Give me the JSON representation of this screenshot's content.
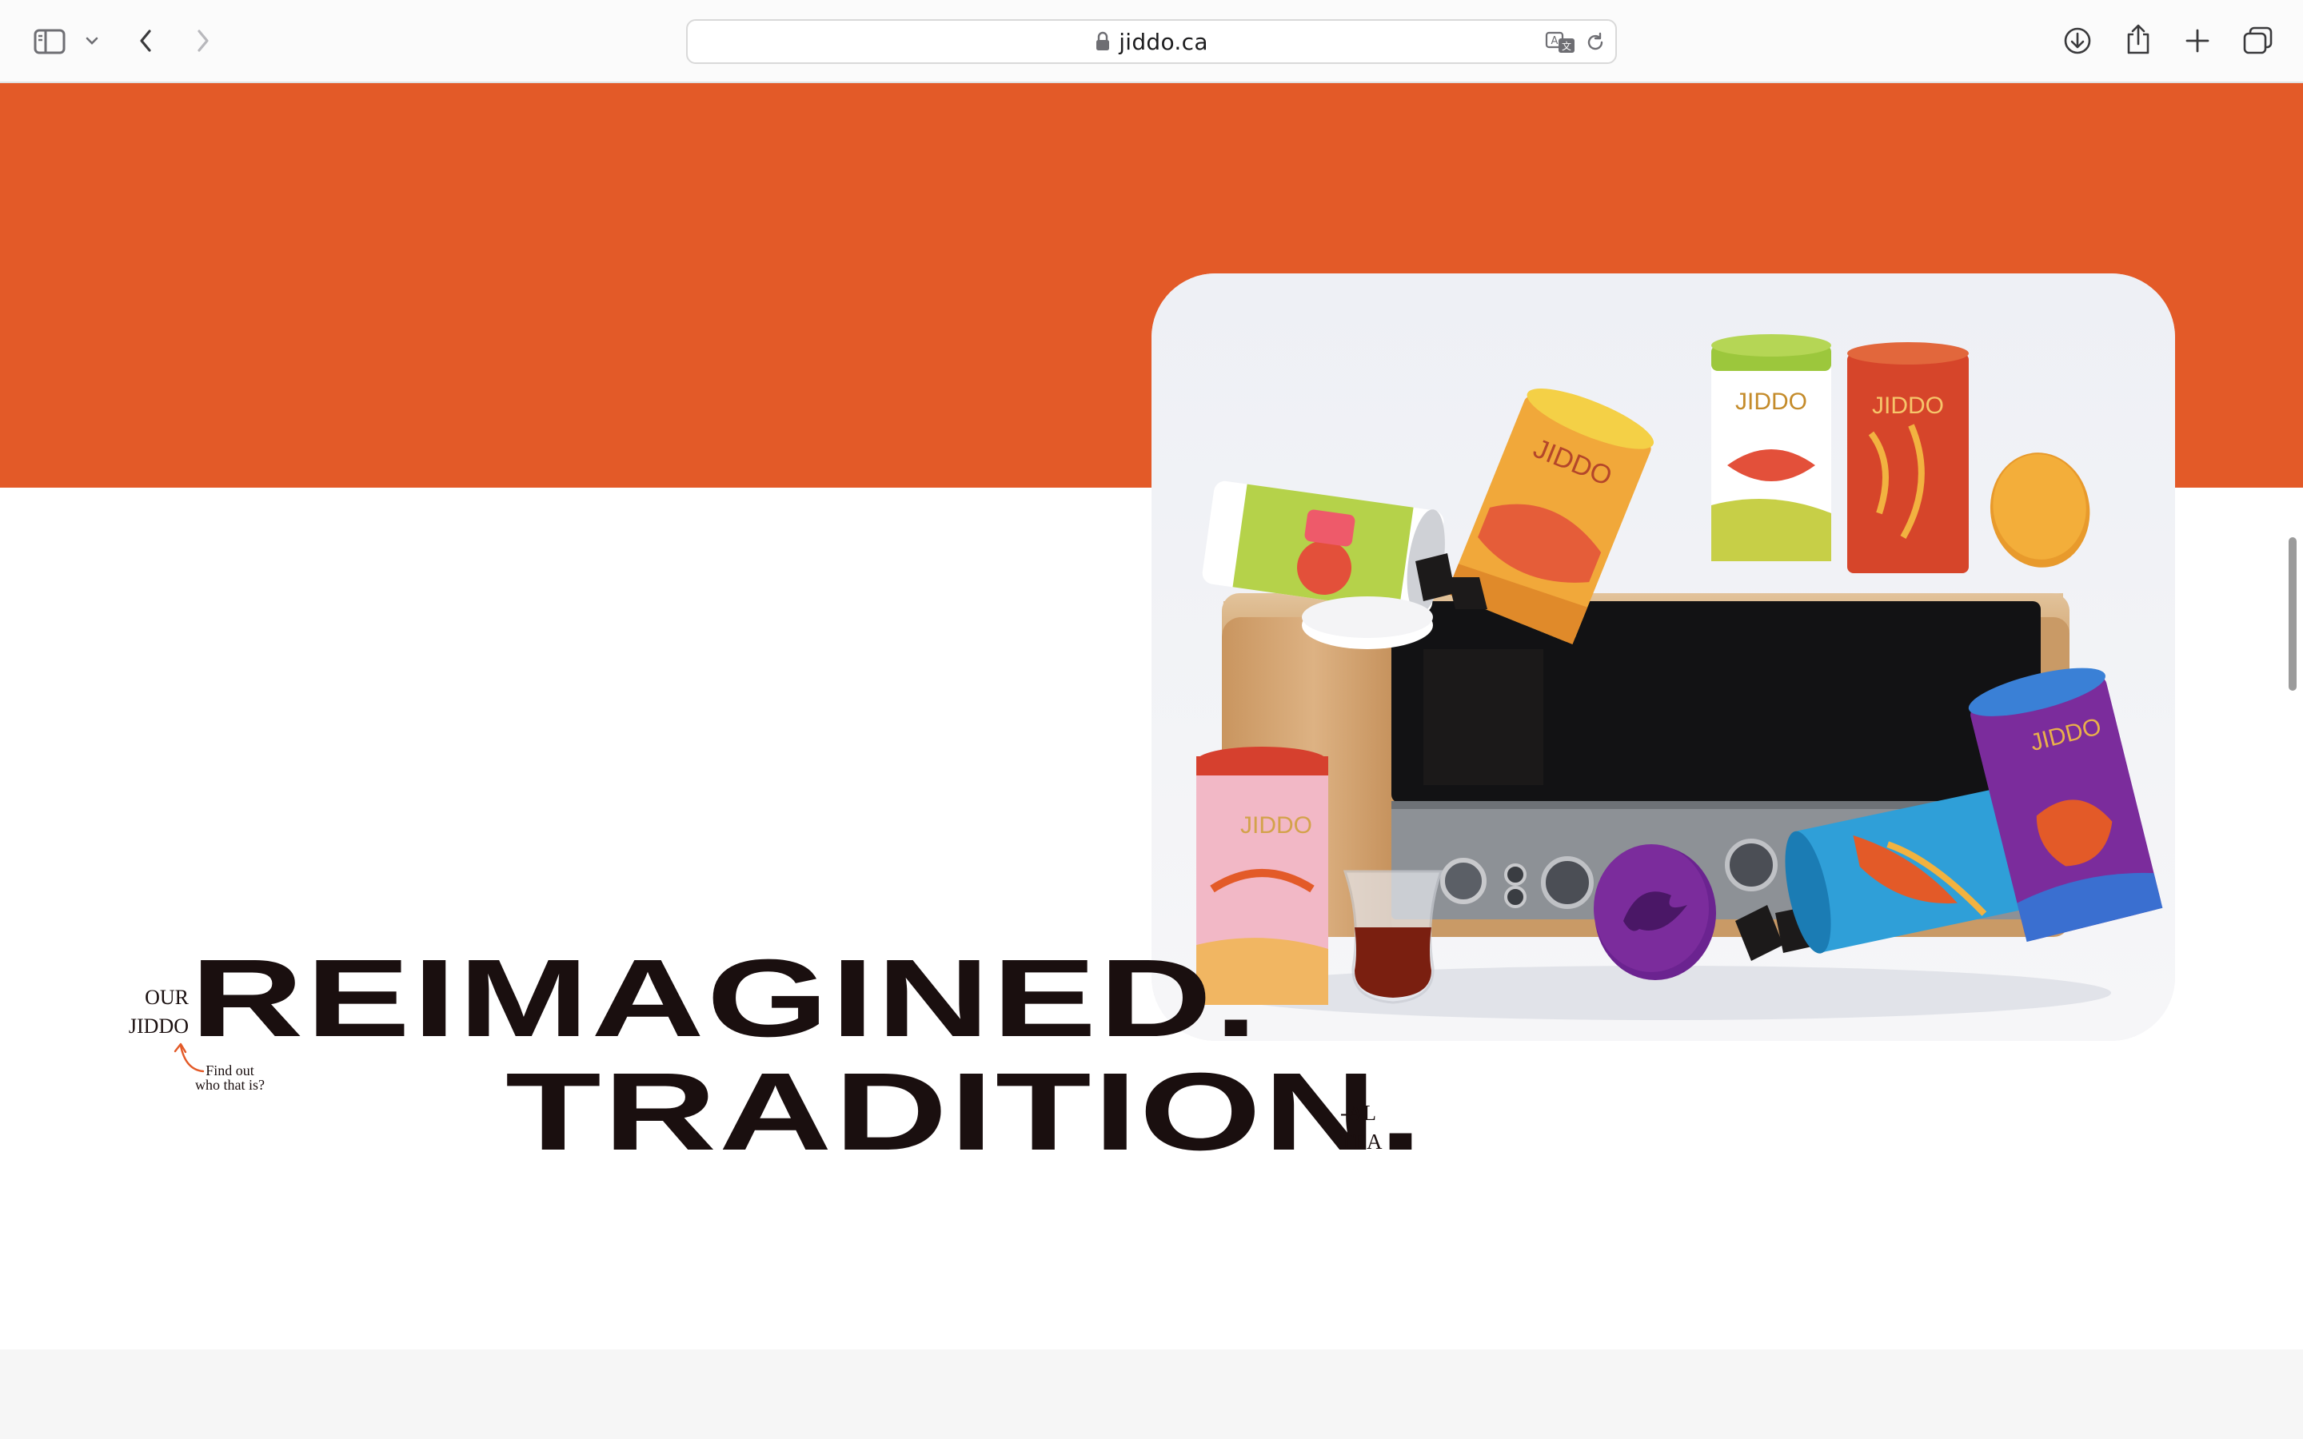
{
  "browser": {
    "url": "jiddo.ca",
    "icons": [
      "sidebar-icon",
      "chevron-down-icon",
      "back-icon",
      "forward-icon",
      "lock-icon",
      "translate-icon",
      "reload-icon",
      "download-icon",
      "share-icon",
      "new-tab-icon",
      "tabs-overview-icon"
    ]
  },
  "hero": {
    "headline_line1": "REIMAGINED.",
    "headline_line2": "TRADITION.",
    "brand_lines": [
      "OUR",
      "JIDDO"
    ],
    "suffix_lines": [
      "-AL",
      "TEA"
    ],
    "find_out_lines": [
      "Find out",
      "who that is?"
    ]
  },
  "product_photo": {
    "brand_mark": "JIDDO",
    "tin_brand_text": "JIDDO"
  },
  "colors": {
    "accent_orange": "#e35a28",
    "text_dark": "#1a0f0f",
    "photo_bg": "#f0f1f5",
    "wood": "#d6aa76",
    "purple": "#7b2c9c",
    "blue": "#2f9fd8",
    "green": "#9cc73c",
    "yellow": "#f1a83a",
    "pink": "#f2b8c6"
  }
}
